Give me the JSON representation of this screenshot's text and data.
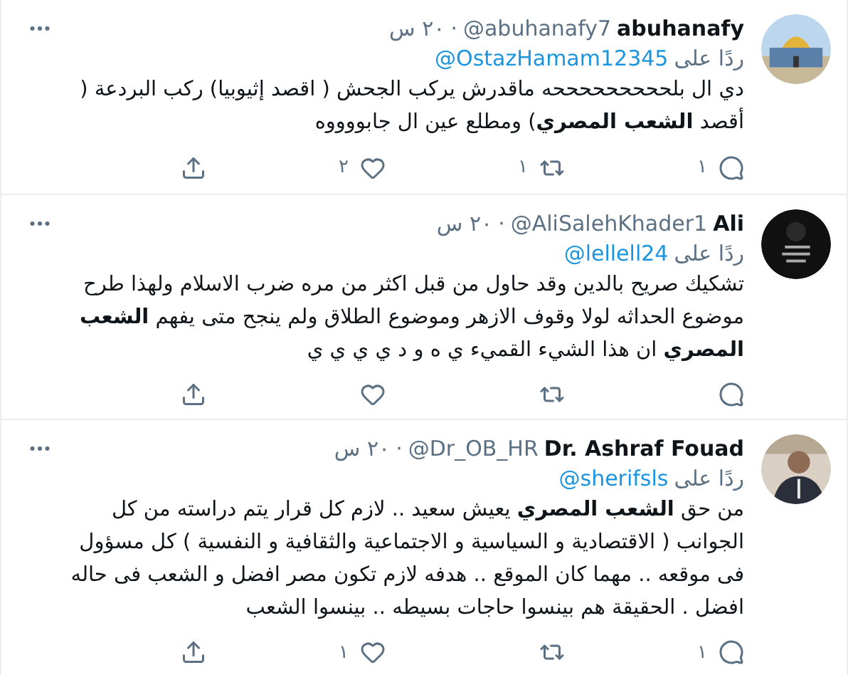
{
  "tweets": [
    {
      "name": "abuhanafy",
      "handle": "@abuhanafy7",
      "dot": "·",
      "time": "٢٠ س",
      "reply_prefix": "ردًا على",
      "reply_to": "@OstazHamam12345",
      "text": "دي ال بلحححححححححه ماقدرش يركب الجحش ( اقصد إثيوبيا) ركب البردعة ( أقصد **الشعب المصري**) ومطلع عين ال جابووووه",
      "replies": "١",
      "retweets": "١",
      "likes": "٢"
    },
    {
      "name": "Ali",
      "handle": "@AliSalehKhader1",
      "dot": "·",
      "time": "٢٠ س",
      "reply_prefix": "ردًا على",
      "reply_to": "@lellell24",
      "text": "تشكيك صريح بالدين وقد حاول من قبل اكثر من مره ضرب الاسلام ولهذا طرح موضوع الحداثه لولا وقوف الازهر وموضوع الطلاق ولم ينجح متى يفهم **الشعب المصري** ان هذا الشيء القميء ي ه و د ي ي ي ي"
    },
    {
      "name": "Dr. Ashraf Fouad",
      "handle": "@Dr_OB_HR",
      "dot": "·",
      "time": "٢٠ س",
      "reply_prefix": "ردًا على",
      "reply_to": "@sherifsls",
      "text": "من حق **الشعب المصري** يعيش سعيد .. لازم كل قرار يتم دراسته من كل الجوانب ( الاقتصادية و السياسية و الاجتماعية والثقافية و النفسية ) كل مسؤول فى موقعه .. مهما كان الموقع .. هدفه لازم تكون مصر افضل و الشعب فى حاله افضل .  الحقيقة هم بينسوا حاجات بسيطه .. بينسوا الشعب",
      "replies": "١",
      "likes": "١"
    }
  ]
}
